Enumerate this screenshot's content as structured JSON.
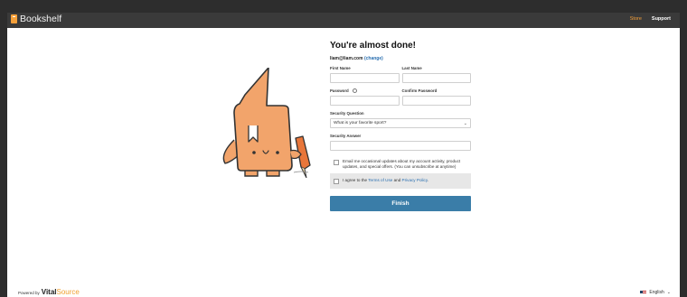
{
  "app": {
    "title": "Bookshelf"
  },
  "nav": {
    "store": "Store",
    "support": "Support"
  },
  "colors": {
    "accent": "#f5a03a",
    "primary": "#3a7da8",
    "link": "#2a6fb0",
    "topbar": "#3a3a3a"
  },
  "form": {
    "title": "You're almost done!",
    "email": "liam@liam.com",
    "change_label": "(change)",
    "first_name_label": "First Name",
    "last_name_label": "Last Name",
    "password_label": "Password",
    "confirm_password_label": "Confirm Password",
    "security_question_label": "Security Question",
    "security_question_value": "What is your favorite sport?",
    "security_answer_label": "Security Answer",
    "email_opt_in_text": "Email me occasional updates about my account activity, product updates, and special offers. (You can unsubscribe at anytime)",
    "terms_prefix": "I agree to the ",
    "terms_link": "Terms of Use",
    "terms_and": " and ",
    "privacy_link": "Privacy Policy",
    "terms_suffix": ".",
    "finish_label": "Finish"
  },
  "footer": {
    "powered_by": "Powered by",
    "brand_vital": "Vital",
    "brand_source": "Source",
    "language": "English",
    "language_chevron": "⌄"
  },
  "icons": {
    "brand": "book-icon",
    "info": "info-icon",
    "chevron": "chevron-down-icon",
    "flag": "us-flag-icon",
    "mascot": "book-mascot-illustration"
  }
}
